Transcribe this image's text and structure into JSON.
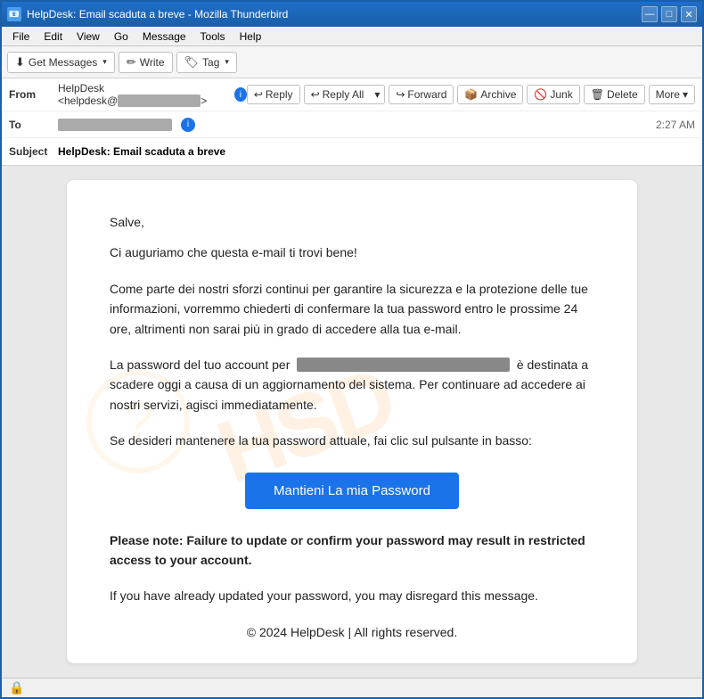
{
  "window": {
    "title": "HelpDesk: Email scaduta a breve - Mozilla Thunderbird",
    "icon": "📧"
  },
  "titlebar": {
    "minimize": "—",
    "maximize": "□",
    "close": "✕"
  },
  "menu": {
    "items": [
      "File",
      "Edit",
      "View",
      "Go",
      "Message",
      "Tools",
      "Help"
    ]
  },
  "toolbar": {
    "get_messages": "Get Messages",
    "write": "Write",
    "tag": "Tag"
  },
  "email_toolbar": {
    "reply": "Reply",
    "reply_all": "Reply All",
    "forward": "Forward",
    "archive": "Archive",
    "junk": "Junk",
    "delete": "Delete",
    "more": "More"
  },
  "header": {
    "from_label": "From",
    "from_value": "HelpDesk <helpdesk@",
    "from_domain": ">",
    "to_label": "To",
    "to_value": "",
    "subject_label": "Subject",
    "subject_value": "HelpDesk: Email scaduta a breve",
    "timestamp": "2:27 AM"
  },
  "email_body": {
    "greeting": "Salve,",
    "line1": "Ci auguriamo che questa e-mail ti trovi bene!",
    "line2": "Come parte dei nostri sforzi continui per garantire la sicurezza e la protezione delle tue informazioni, vorremmo chiederti di confermare la tua password entro le prossime 24 ore, altrimenti non sarai più in grado di accedere alla tua e-mail.",
    "line3_prefix": "La password del tuo account per",
    "line3_suffix": "è destinata a scadere oggi a causa di un aggiornamento del sistema. Per continuare ad accedere ai nostri servizi, agisci immediatamente.",
    "line4": "Se desideri mantenere la tua password attuale, fai clic sul pulsante in basso:",
    "button": "Mantieni La mia Password",
    "warning": "Please note: Failure to update or confirm your password may result in restricted access to your account.",
    "note": "If you have already updated your password, you may disregard this message.",
    "footer": "© 2024 HelpDesk | All rights reserved."
  },
  "status_bar": {
    "icon": "🔒",
    "text": ""
  },
  "colors": {
    "accent": "#1a73e8",
    "warning": "#d32f2f",
    "title_bar": "#1a5fa8"
  }
}
